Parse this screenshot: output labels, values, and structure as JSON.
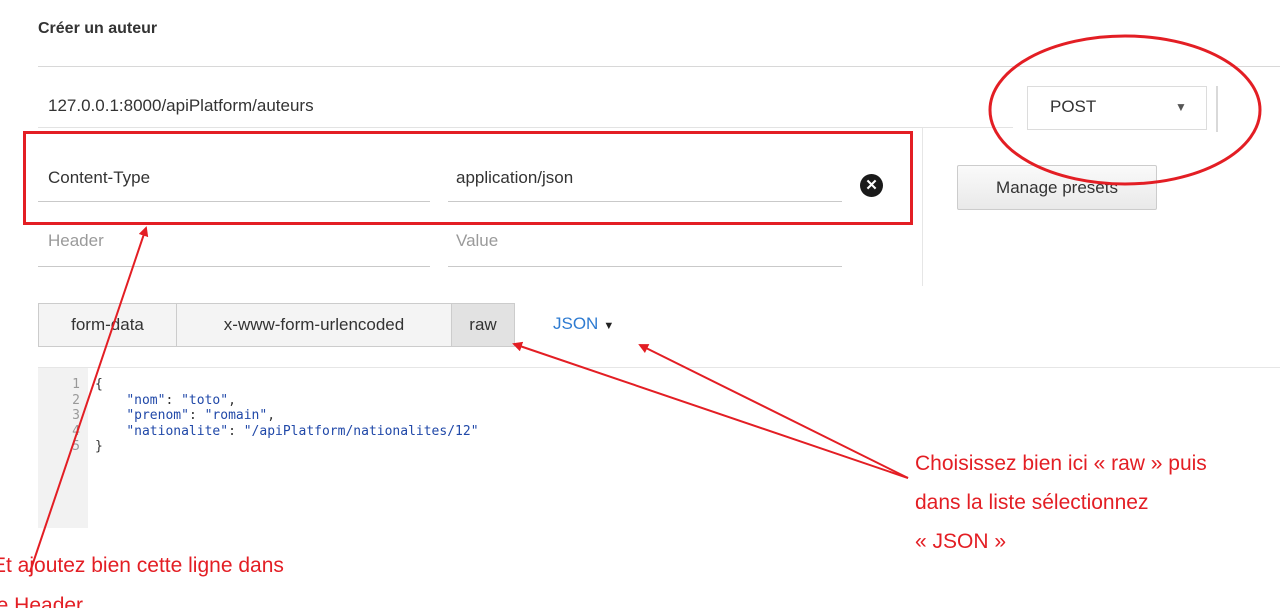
{
  "page": {
    "title": "Créer un auteur"
  },
  "request": {
    "url": "127.0.0.1:8000/apiPlatform/auteurs",
    "method": "POST"
  },
  "headers": {
    "rows": [
      {
        "key": "Content-Type",
        "value": "application/json"
      }
    ],
    "placeholder_key": "Header",
    "placeholder_value": "Value",
    "manage_presets_label": "Manage presets"
  },
  "body": {
    "tabs": [
      {
        "label": "form-data",
        "active": false
      },
      {
        "label": "x-www-form-urlencoded",
        "active": false
      },
      {
        "label": "raw",
        "active": true
      }
    ],
    "language": "JSON",
    "editor": {
      "line_numbers": [
        "1",
        "2",
        "3",
        "4",
        "5"
      ],
      "open_brace": "{",
      "close_brace": "}",
      "fields": [
        {
          "key": "\"nom\"",
          "value": "\"toto\""
        },
        {
          "key": "\"prenom\"",
          "value": "\"romain\""
        },
        {
          "key": "\"nationalite\"",
          "value": "\"/apiPlatform/nationalites/12\""
        }
      ]
    }
  },
  "annotations": {
    "right_note_lines": [
      "Choisissez bien ici « raw » puis",
      "dans la liste sélectionnez",
      "« JSON »"
    ],
    "left_note_lines": [
      "Et ajoutez bien cette ligne dans",
      "le Header"
    ],
    "color": "#e31e24"
  }
}
